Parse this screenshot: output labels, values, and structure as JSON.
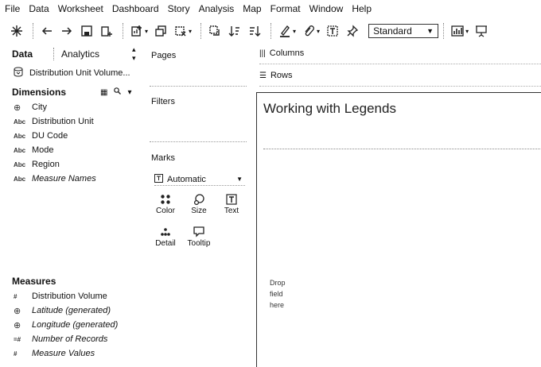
{
  "menu": [
    "File",
    "Data",
    "Worksheet",
    "Dashboard",
    "Story",
    "Analysis",
    "Map",
    "Format",
    "Window",
    "Help"
  ],
  "toolbar": {
    "view_size": "Standard"
  },
  "data_pane": {
    "tab_data": "Data",
    "tab_analytics": "Analytics",
    "datasource": "Distribution Unit Volume...",
    "dimensions_label": "Dimensions",
    "dimensions": [
      {
        "type": "globe",
        "name": "City"
      },
      {
        "type": "Abc",
        "name": "Distribution Unit"
      },
      {
        "type": "Abc",
        "name": "DU Code"
      },
      {
        "type": "Abc",
        "name": "Mode"
      },
      {
        "type": "Abc",
        "name": "Region"
      },
      {
        "type": "Abc",
        "name": "Measure Names"
      }
    ],
    "measures_label": "Measures",
    "measures": [
      {
        "type": "#",
        "name": "Distribution Volume"
      },
      {
        "type": "globe",
        "name": "Latitude (generated)"
      },
      {
        "type": "globe",
        "name": "Longitude (generated)"
      },
      {
        "type": "=#",
        "name": "Number of Records"
      },
      {
        "type": "#",
        "name": "Measure Values"
      }
    ]
  },
  "shelves": {
    "pages": "Pages",
    "filters": "Filters",
    "marks": "Marks",
    "mark_type": "Automatic",
    "color": "Color",
    "size": "Size",
    "text": "Text",
    "detail": "Detail",
    "tooltip": "Tooltip",
    "columns": "Columns",
    "rows": "Rows"
  },
  "sheet": {
    "title": "Working with Legends",
    "drop_1": "Drop",
    "drop_2": "field",
    "drop_3": "here"
  }
}
